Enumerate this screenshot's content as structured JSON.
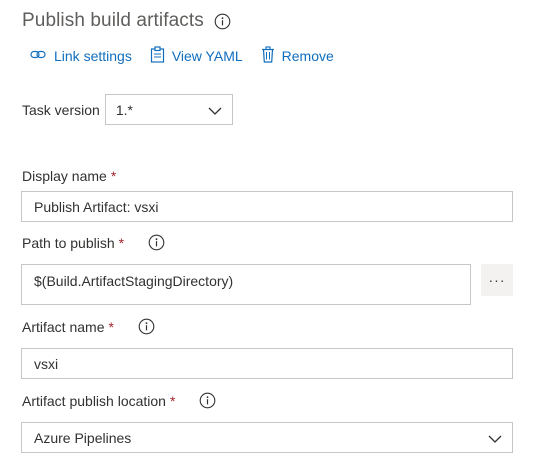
{
  "header": {
    "title": "Publish build artifacts",
    "info_icon": "info-icon"
  },
  "actions": [
    {
      "label": "Link settings",
      "icon": "link-icon"
    },
    {
      "label": "View YAML",
      "icon": "clipboard-icon"
    },
    {
      "label": "Remove",
      "icon": "trash-icon"
    }
  ],
  "task_version": {
    "label": "Task version",
    "value": "1.*"
  },
  "fields": {
    "display_name": {
      "label": "Display name",
      "required": "*",
      "value": "Publish Artifact: vsxi"
    },
    "path_to_publish": {
      "label": "Path to publish",
      "required": "*",
      "value": "$(Build.ArtifactStagingDirectory)",
      "browse_label": "···"
    },
    "artifact_name": {
      "label": "Artifact name",
      "required": "*",
      "value": "vsxi"
    },
    "publish_location": {
      "label": "Artifact publish location",
      "required": "*",
      "value": "Azure Pipelines"
    }
  },
  "colors": {
    "accent": "#106ebe",
    "required": "#a4262c",
    "border": "#c8c6c4"
  }
}
